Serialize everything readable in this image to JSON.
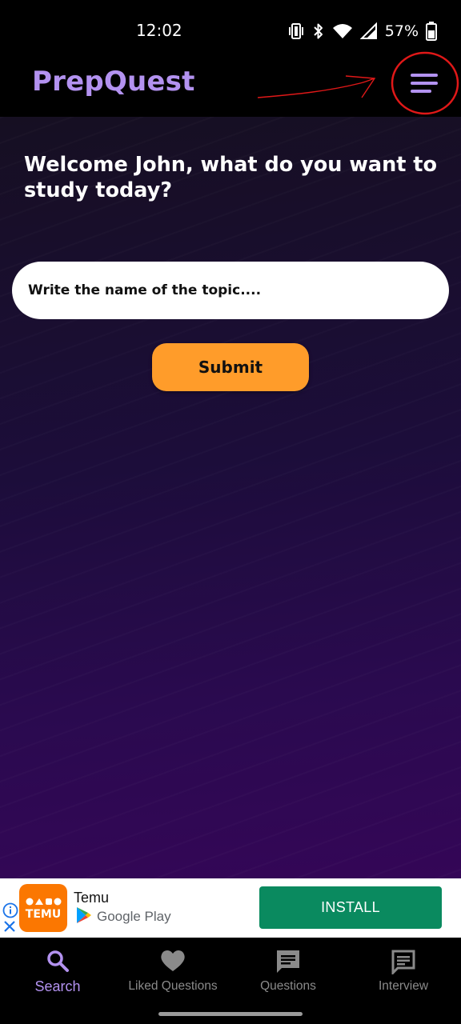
{
  "status_bar": {
    "time": "12:02",
    "battery_percent": "57%",
    "icons": [
      "vibrate-icon",
      "bluetooth-icon",
      "wifi-icon",
      "cellular-icon",
      "battery-icon"
    ]
  },
  "app_bar": {
    "title": "PrepQuest",
    "menu_icon": "hamburger-menu-icon",
    "accent_color": "#b392f0"
  },
  "annotation": {
    "shapes": [
      "red-arrow",
      "red-circle"
    ],
    "color": "#e01818"
  },
  "main": {
    "welcome_text": "Welcome John, what do you want to study today?",
    "topic_input": {
      "placeholder": "Write the name of the topic....",
      "value": ""
    },
    "submit_label": "Submit",
    "submit_color": "#ff9c2a"
  },
  "ad": {
    "app_name": "Temu",
    "store_name": "Google Play",
    "logo_text": "TEMU",
    "install_label": "INSTALL",
    "install_color": "#0a8a5f",
    "icons": [
      "ad-info-icon",
      "ad-close-icon",
      "google-play-icon"
    ]
  },
  "bottom_nav": {
    "items": [
      {
        "label": "Search",
        "icon": "search-icon",
        "active": true
      },
      {
        "label": "Liked Questions",
        "icon": "heart-icon",
        "active": false
      },
      {
        "label": "Questions",
        "icon": "chat-icon",
        "active": false
      },
      {
        "label": "Interview",
        "icon": "message-icon",
        "active": false
      }
    ]
  }
}
